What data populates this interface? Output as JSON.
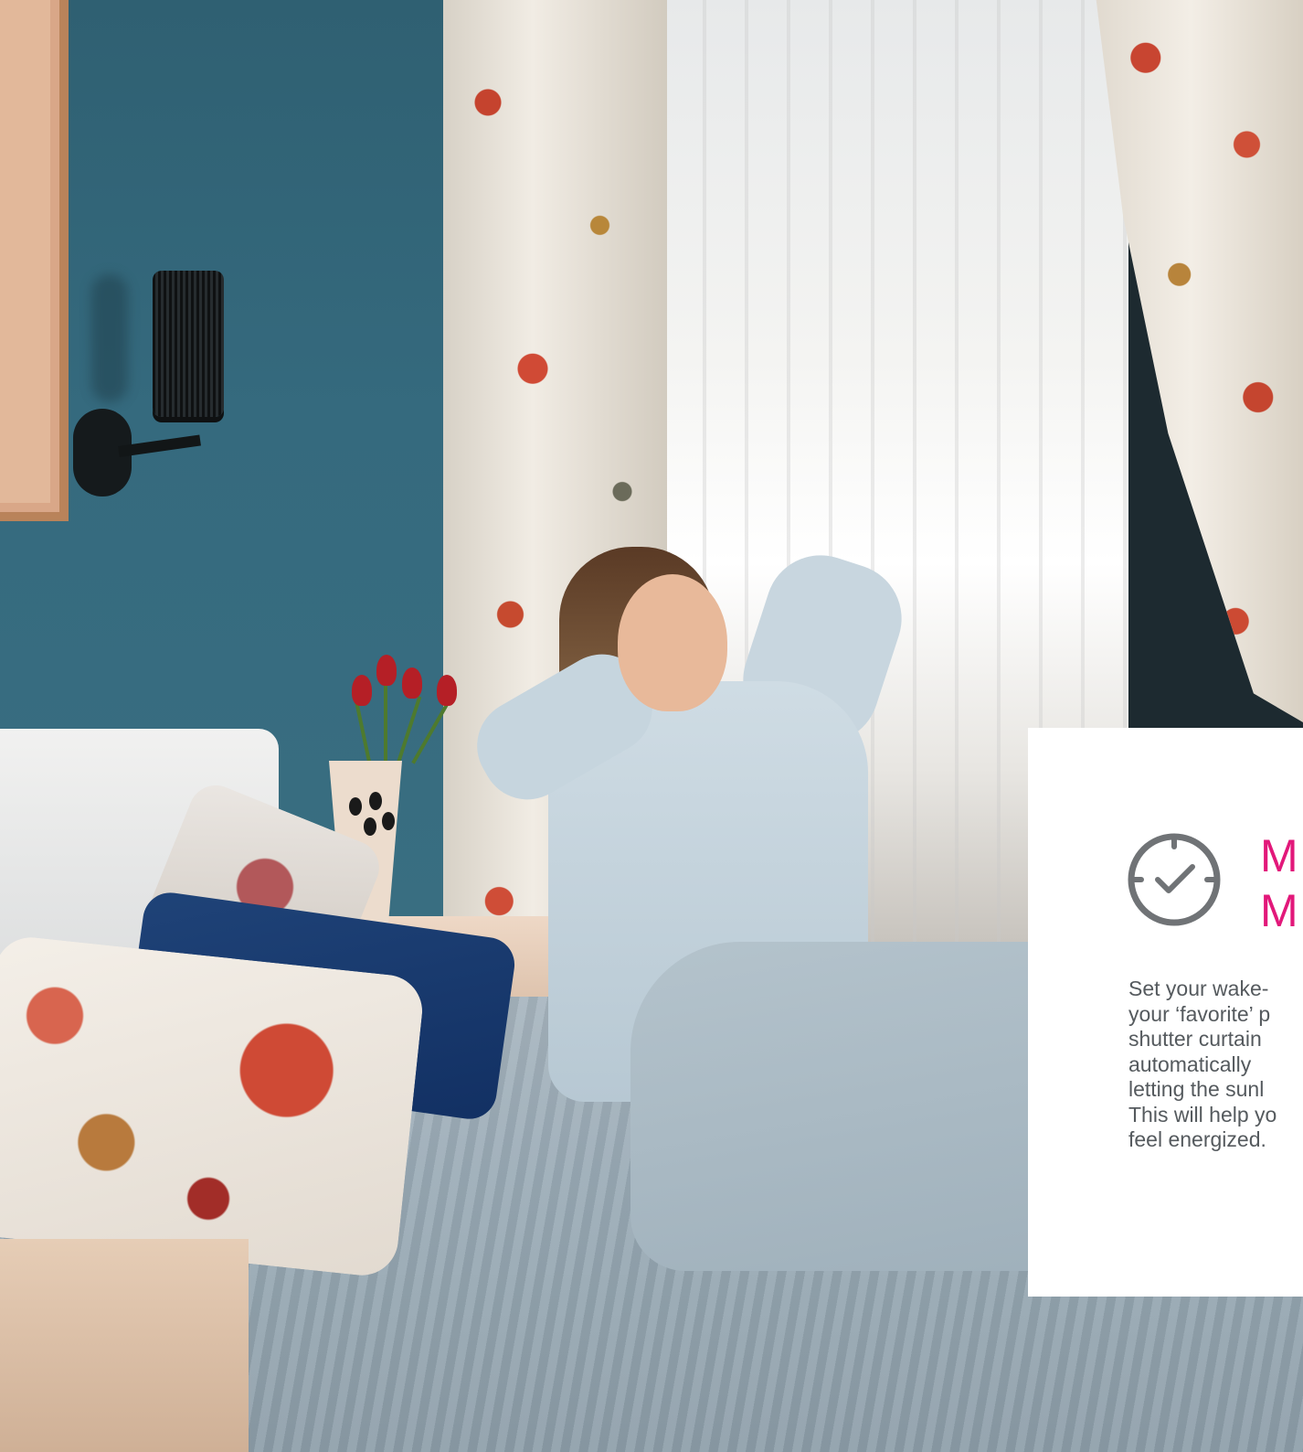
{
  "feature_card": {
    "icon": "clock-icon",
    "accent_color": "#e2187a",
    "title_lines": [
      "M",
      "M"
    ],
    "body_lines": [
      "Set your wake-",
      "your ‘favorite’ p",
      "shutter curtain",
      "automatically",
      "letting the sunl",
      "This will help yo",
      "feel energized."
    ]
  }
}
